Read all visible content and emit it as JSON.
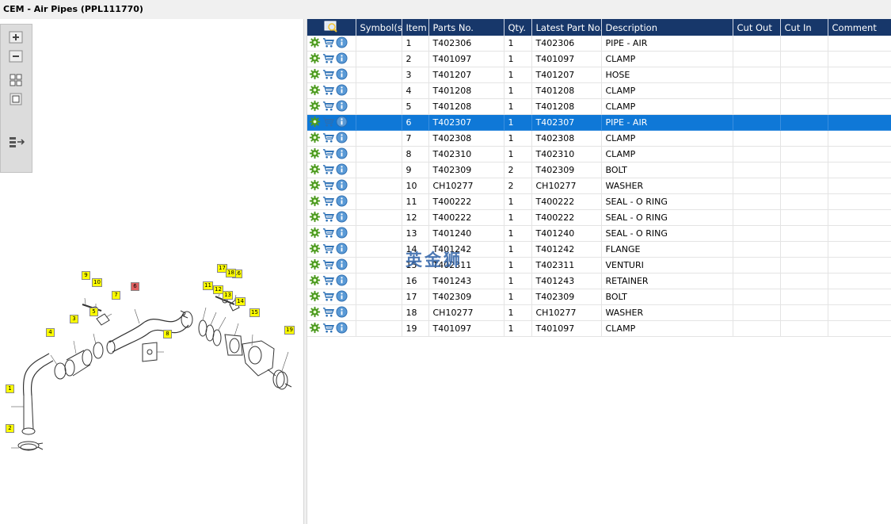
{
  "window": {
    "title": "CEM - Air Pipes (PPL111770)"
  },
  "toolbar": {
    "icons": [
      "zoom-in-icon",
      "zoom-out-icon",
      "fit-all-icon",
      "fit-page-icon",
      "toggle-list-icon"
    ]
  },
  "diagram": {
    "callouts": [
      "1",
      "2",
      "3",
      "4",
      "5",
      "6",
      "7",
      "8",
      "9",
      "10",
      "11",
      "12",
      "13",
      "14",
      "15",
      "16",
      "17",
      "18",
      "19"
    ],
    "highlighted": "6"
  },
  "table": {
    "headers": {
      "symbols": "Symbol(s)",
      "item": "Item",
      "part": "Parts No.",
      "qty": "Qty.",
      "latest": "Latest Part No.",
      "desc": "Description",
      "cutout": "Cut Out",
      "cutin": "Cut In",
      "comment": "Comment"
    },
    "rows": [
      {
        "item": "1",
        "part": "T402306",
        "qty": "1",
        "latest": "T402306",
        "desc": "PIPE - AIR"
      },
      {
        "item": "2",
        "part": "T401097",
        "qty": "1",
        "latest": "T401097",
        "desc": "CLAMP"
      },
      {
        "item": "3",
        "part": "T401207",
        "qty": "1",
        "latest": "T401207",
        "desc": "HOSE"
      },
      {
        "item": "4",
        "part": "T401208",
        "qty": "1",
        "latest": "T401208",
        "desc": "CLAMP"
      },
      {
        "item": "5",
        "part": "T401208",
        "qty": "1",
        "latest": "T401208",
        "desc": "CLAMP"
      },
      {
        "item": "6",
        "part": "T402307",
        "qty": "1",
        "latest": "T402307",
        "desc": "PIPE - AIR"
      },
      {
        "item": "7",
        "part": "T402308",
        "qty": "1",
        "latest": "T402308",
        "desc": "CLAMP"
      },
      {
        "item": "8",
        "part": "T402310",
        "qty": "1",
        "latest": "T402310",
        "desc": "CLAMP"
      },
      {
        "item": "9",
        "part": "T402309",
        "qty": "2",
        "latest": "T402309",
        "desc": "BOLT"
      },
      {
        "item": "10",
        "part": "CH10277",
        "qty": "2",
        "latest": "CH10277",
        "desc": "WASHER"
      },
      {
        "item": "11",
        "part": "T400222",
        "qty": "1",
        "latest": "T400222",
        "desc": "SEAL - O RING"
      },
      {
        "item": "12",
        "part": "T400222",
        "qty": "1",
        "latest": "T400222",
        "desc": "SEAL - O RING"
      },
      {
        "item": "13",
        "part": "T401240",
        "qty": "1",
        "latest": "T401240",
        "desc": "SEAL - O RING"
      },
      {
        "item": "14",
        "part": "T401242",
        "qty": "1",
        "latest": "T401242",
        "desc": "FLANGE"
      },
      {
        "item": "15",
        "part": "T402311",
        "qty": "1",
        "latest": "T402311",
        "desc": "VENTURI"
      },
      {
        "item": "16",
        "part": "T401243",
        "qty": "1",
        "latest": "T401243",
        "desc": "RETAINER"
      },
      {
        "item": "17",
        "part": "T402309",
        "qty": "1",
        "latest": "T402309",
        "desc": "BOLT"
      },
      {
        "item": "18",
        "part": "CH10277",
        "qty": "1",
        "latest": "CH10277",
        "desc": "WASHER"
      },
      {
        "item": "19",
        "part": "T401097",
        "qty": "1",
        "latest": "T401097",
        "desc": "CLAMP"
      }
    ],
    "selected_item": "6"
  },
  "watermark": {
    "text": "英金狮"
  },
  "colors": {
    "header_bg": "#17376a",
    "selection": "#0f78d7",
    "callout": "#ffff00",
    "callout_selected": "#e06060"
  }
}
